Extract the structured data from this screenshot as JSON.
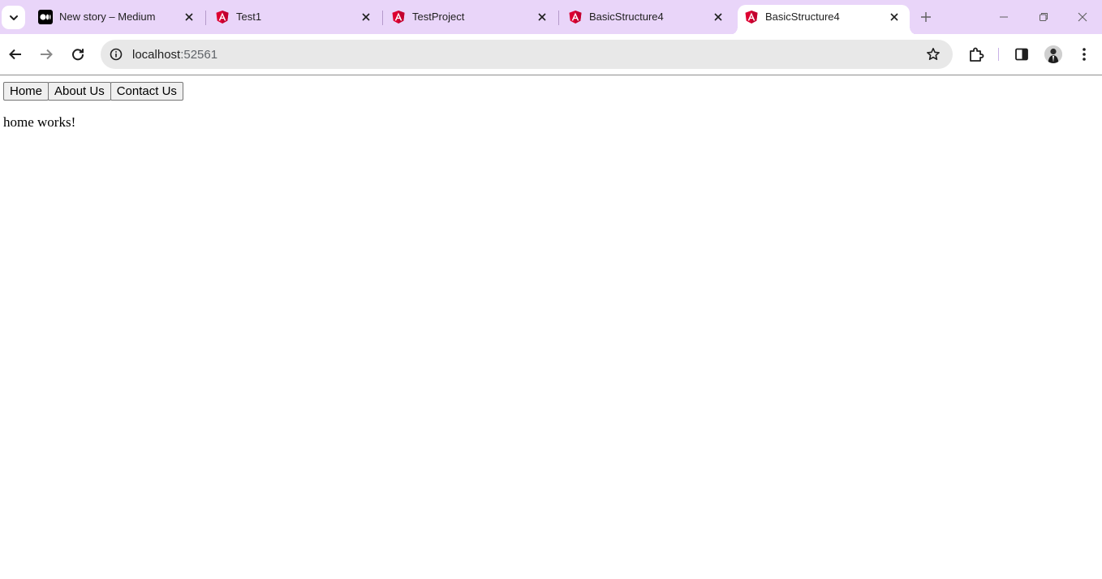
{
  "browser": {
    "tabs": [
      {
        "title": "New story – Medium",
        "favicon": "medium-icon"
      },
      {
        "title": "Test1",
        "favicon": "angular-icon"
      },
      {
        "title": "TestProject",
        "favicon": "angular-icon"
      },
      {
        "title": "BasicStructure4",
        "favicon": "angular-icon"
      },
      {
        "title": "BasicStructure4",
        "favicon": "angular-icon",
        "active": true
      }
    ],
    "address": {
      "host": "localhost",
      "port": ":52561"
    },
    "colors": {
      "tabstrip": "#e9d5f9",
      "angular": "#dd0031",
      "angular_alt": "#c3002f"
    }
  },
  "page": {
    "nav": [
      "Home",
      "About Us",
      "Contact Us"
    ],
    "message": "home works!"
  }
}
